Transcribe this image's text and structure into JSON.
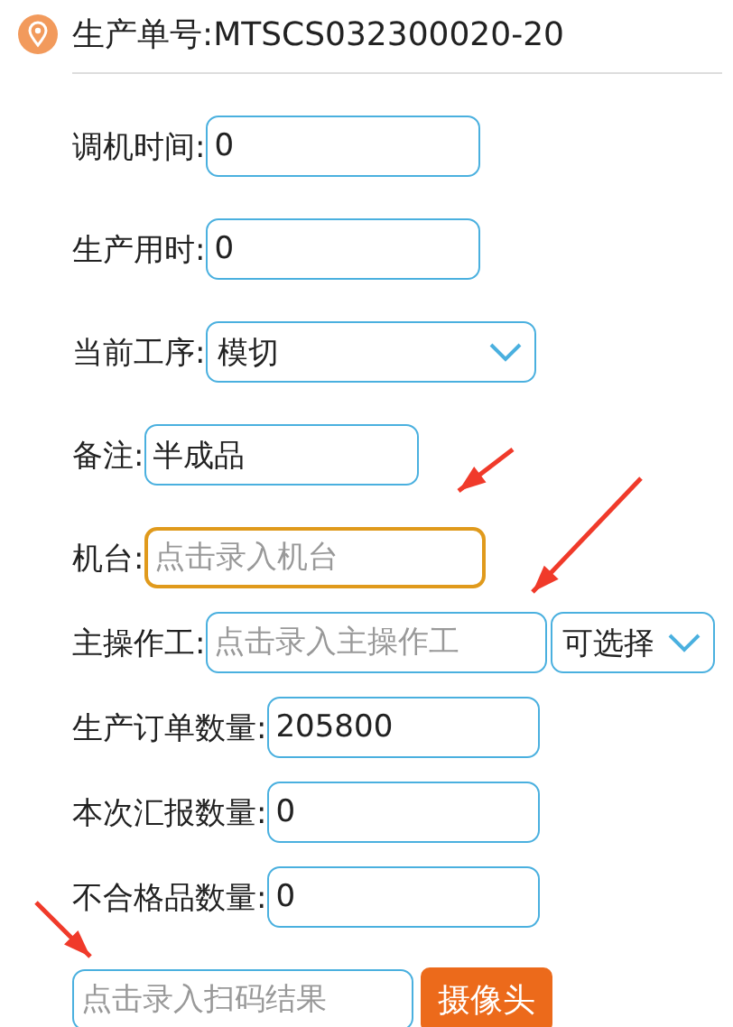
{
  "header": {
    "title": "生产单号:MTSCS032300020-20"
  },
  "fields": [
    {
      "kind": "input",
      "label": "调机时间:",
      "value": "0",
      "focused": false
    },
    {
      "kind": "input",
      "label": "生产用时:",
      "value": "0",
      "focused": false
    },
    {
      "kind": "select",
      "label": "当前工序:",
      "value": "模切",
      "focused": false
    },
    {
      "kind": "input",
      "label": "备注:",
      "value": "半成品",
      "focused": false
    },
    {
      "kind": "input",
      "label": "机台:",
      "placeholder": "点击录入机台",
      "focused": true
    },
    {
      "kind": "input_select",
      "label": "主操作工:",
      "placeholder": "点击录入主操作工",
      "option": "可选择",
      "focused": false
    },
    {
      "kind": "input",
      "label": "生产订单数量:",
      "value": "205800",
      "focused": false
    },
    {
      "kind": "input",
      "label": "本次汇报数量:",
      "value": "0",
      "focused": false
    },
    {
      "kind": "input",
      "label": "不合格品数量:",
      "value": "0",
      "focused": false
    }
  ],
  "scan": {
    "placeholder": "点击录入扫码结果",
    "button": "摄像头"
  }
}
